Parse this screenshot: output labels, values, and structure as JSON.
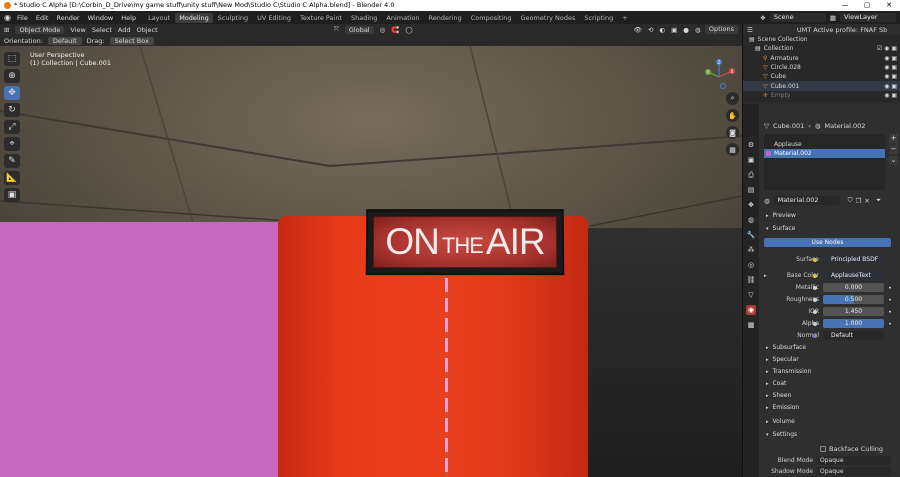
{
  "window": {
    "title": "* Studio C Alpha [D:\\Corbin_D_Drive\\my game stuff\\unity stuff\\New Mod\\Studio C\\Studio C Alpha.blend] - Blender 4.0",
    "controls": [
      "—",
      "▢",
      "✕"
    ]
  },
  "menu": {
    "items": [
      "File",
      "Edit",
      "Render",
      "Window",
      "Help"
    ],
    "workspaces": [
      "Layout",
      "Modeling",
      "Sculpting",
      "UV Editing",
      "Texture Paint",
      "Shading",
      "Animation",
      "Rendering",
      "Compositing",
      "Geometry Nodes",
      "Scripting"
    ],
    "active_workspace": "Modeling",
    "add_tab": "+",
    "scene": "Scene",
    "view_layer": "ViewLayer"
  },
  "viewport_header": {
    "mode": "Object Mode",
    "menus": [
      "View",
      "Select",
      "Add",
      "Object"
    ],
    "transform": "Global",
    "options": "Options"
  },
  "tool_header": {
    "orientation_label": "Orientation:",
    "orientation_value": "Default",
    "drag_label": "Drag:",
    "drag_value": "Select Box"
  },
  "viewport": {
    "view_name": "User Perspective",
    "selection_info": "(1) Collection | Cube.001",
    "sign_words": [
      "ON",
      "THE",
      "AIR"
    ],
    "gizmo_axes": [
      "X",
      "Y",
      "Z"
    ]
  },
  "outliner": {
    "header_profile": "UMT Active profile: FNAF Sb",
    "rows": [
      {
        "label": "Scene Collection",
        "icon": "collection-icon",
        "dim": false
      },
      {
        "label": "Collection",
        "icon": "collection-icon",
        "dim": false
      },
      {
        "label": "Armature",
        "icon": "armature-icon",
        "dim": false
      },
      {
        "label": "Circle.028",
        "icon": "mesh-icon",
        "dim": false
      },
      {
        "label": "Cube",
        "icon": "mesh-icon",
        "dim": false
      },
      {
        "label": "Cube.001",
        "icon": "mesh-icon",
        "dim": false
      },
      {
        "label": "Empty",
        "icon": "empty-icon",
        "dim": true
      }
    ]
  },
  "properties": {
    "breadcrumb_object": "Cube.001",
    "breadcrumb_material": "Material.002",
    "material_slots": [
      {
        "label": "Applause",
        "color": "#2a2a2a",
        "selected": false
      },
      {
        "label": "Material.002",
        "color": "#c867c0",
        "selected": true
      }
    ],
    "material_name": "Material.002",
    "sections": {
      "preview": "Preview",
      "surface": "Surface",
      "subsurface": "Subsurface",
      "specular": "Specular",
      "transmission": "Transmission",
      "coat": "Coat",
      "sheen": "Sheen",
      "emission": "Emission",
      "volume": "Volume",
      "settings": "Settings"
    },
    "use_nodes": "Use Nodes",
    "surface_label": "Surface",
    "surface_value": "Principled BSDF",
    "base_color_label": "Base Color",
    "base_color_value": "ApplauseText",
    "metallic_label": "Metallic",
    "metallic_value": "0.000",
    "roughness_label": "Roughness",
    "roughness_value": "0.500",
    "roughness_fill": 0.5,
    "ior_label": "IOR",
    "ior_value": "1.450",
    "alpha_label": "Alpha",
    "alpha_value": "1.000",
    "normal_label": "Normal",
    "normal_value": "Default",
    "backface_culling": "Backface Culling",
    "blend_mode_label": "Blend Mode",
    "blend_mode_value": "Opaque",
    "shadow_mode_label": "Shadow Mode",
    "shadow_mode_value": "Opaque"
  },
  "colors": {
    "accent": "#4772b3",
    "pink_wall": "#c867c0",
    "red_cylinder": "#e63a1a",
    "sign_red": "#a2302c"
  }
}
